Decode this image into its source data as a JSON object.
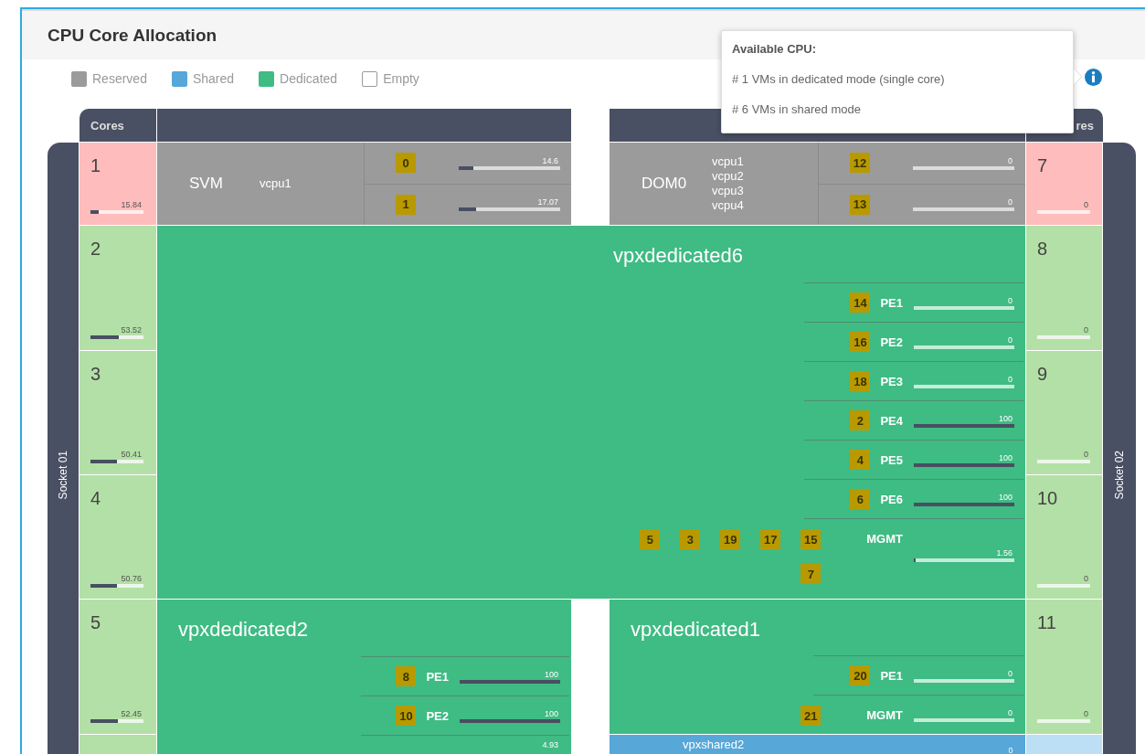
{
  "title": "CPU Core Allocation",
  "legend": [
    {
      "label": "Reserved",
      "kind": "reserved"
    },
    {
      "label": "Shared",
      "kind": "shared"
    },
    {
      "label": "Dedicated",
      "kind": "dedicated"
    },
    {
      "label": "Empty",
      "kind": "empty"
    }
  ],
  "tooltip": {
    "heading": "Available CPU:",
    "lines": [
      "# 1 VMs in dedicated mode (single core)",
      "# 6 VMs in shared mode"
    ]
  },
  "table_header": {
    "left": "Cores",
    "right": "res"
  },
  "sockets": [
    {
      "label": "Socket 01",
      "cores": [
        {
          "number": "1",
          "kind": "reserved",
          "level": 0.1584,
          "reading": "15.84"
        },
        {
          "number": "2",
          "kind": "dedicated",
          "level": 0.5352,
          "reading": "53.52"
        },
        {
          "number": "3",
          "kind": "dedicated",
          "level": 0.5041,
          "reading": "50.41"
        },
        {
          "number": "4",
          "kind": "dedicated",
          "level": 0.5076,
          "reading": "50.76"
        },
        {
          "number": "5",
          "kind": "dedicated",
          "level": 0.5245,
          "reading": "52.45"
        },
        {
          "kind": "dedicated"
        }
      ]
    },
    {
      "label": "Socket 02",
      "cores": [
        {
          "number": "7",
          "kind": "reserved",
          "level": 0,
          "reading": "0"
        },
        {
          "number": "8",
          "kind": "dedicated",
          "level": 0,
          "reading": "0"
        },
        {
          "number": "9",
          "kind": "dedicated",
          "level": 0,
          "reading": "0"
        },
        {
          "number": "10",
          "kind": "dedicated",
          "level": 0,
          "reading": "0"
        },
        {
          "number": "11",
          "kind": "dedicated",
          "level": 0,
          "reading": "0"
        },
        {
          "kind": "shared"
        }
      ]
    }
  ],
  "vms": [
    {
      "name": "SVM",
      "kind": "reserved",
      "vcpus": [
        "vcpu1"
      ],
      "rows": [
        {
          "kind": "core",
          "badges": [
            "0"
          ],
          "level": 0.146,
          "reading": "14.6"
        },
        {
          "kind": "core",
          "badges": [
            "1"
          ],
          "level": 0.1707,
          "reading": "17.07"
        }
      ]
    },
    {
      "name": "DOM0",
      "kind": "reserved",
      "vcpus": [
        "vcpu1",
        "vcpu2",
        "vcpu3",
        "vcpu4"
      ],
      "rows": [
        {
          "kind": "core",
          "badges": [
            "12"
          ],
          "level": 0,
          "reading": "0"
        },
        {
          "kind": "core",
          "badges": [
            "13"
          ],
          "level": 0,
          "reading": "0"
        }
      ]
    },
    {
      "name": "vpxdedicated6",
      "kind": "dedicated",
      "rows": [
        {
          "kind": "engine",
          "badges": [
            "14"
          ],
          "label": "PE1",
          "level": 0,
          "reading": "0"
        },
        {
          "kind": "engine",
          "badges": [
            "16"
          ],
          "label": "PE2",
          "level": 0,
          "reading": "0"
        },
        {
          "kind": "engine",
          "badges": [
            "18"
          ],
          "label": "PE3",
          "level": 0,
          "reading": "0"
        },
        {
          "kind": "engine",
          "badges": [
            "2"
          ],
          "label": "PE4",
          "level": 1,
          "reading": "100"
        },
        {
          "kind": "engine",
          "badges": [
            "4"
          ],
          "label": "PE5",
          "level": 1,
          "reading": "100"
        },
        {
          "kind": "engine",
          "badges": [
            "6"
          ],
          "label": "PE6",
          "level": 1,
          "reading": "100"
        },
        {
          "kind": "mgmt",
          "badges": [
            "5",
            "3",
            "19",
            "17",
            "15",
            "7"
          ],
          "label": "MGMT",
          "level": 0.0156,
          "reading": "1.56"
        }
      ]
    },
    {
      "name": "vpxdedicated2",
      "kind": "dedicated",
      "rows": [
        {
          "kind": "engine",
          "badges": [
            "8"
          ],
          "label": "PE1",
          "level": 1,
          "reading": "100"
        },
        {
          "kind": "engine",
          "badges": [
            "10"
          ],
          "label": "PE2",
          "level": 1,
          "reading": "100"
        },
        {
          "kind": "mgmt",
          "reading": "4.93"
        }
      ]
    },
    {
      "name": "vpxdedicated1",
      "kind": "dedicated",
      "rows": [
        {
          "kind": "engine",
          "badges": [
            "20"
          ],
          "label": "PE1",
          "level": 0,
          "reading": "0"
        },
        {
          "kind": "mgmt",
          "badges": [
            "21"
          ],
          "label": "MGMT",
          "level": 0,
          "reading": "0"
        }
      ]
    },
    {
      "name": "vpxshared2",
      "kind": "shared",
      "rows": [
        {
          "kind": "core",
          "reading": "0"
        }
      ]
    }
  ]
}
